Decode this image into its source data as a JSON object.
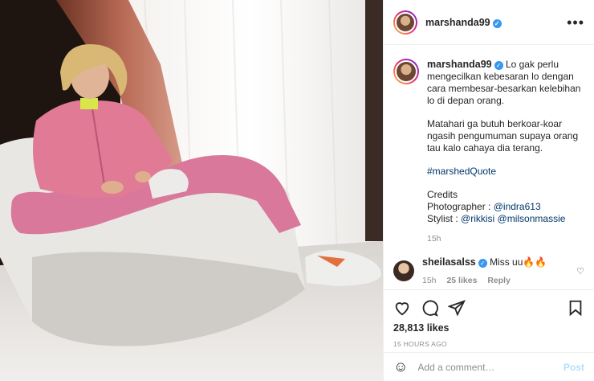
{
  "colors": {
    "accent": "#3897f0",
    "post_button_disabled": "#b2dffc",
    "link": "#00376b",
    "muted": "#8e8e8e"
  },
  "header": {
    "username": "marshanda99",
    "verified_icon": "verified-badge-icon",
    "more_icon": "more-options-icon"
  },
  "caption": {
    "username": "marshanda99",
    "paragraph1": "Lo gak perlu mengecilkan kebesaran lo dengan cara membesar-besarkan kelebihan lo di depan orang.",
    "paragraph2": "Matahari ga butuh berkoar-koar ngasih pengumuman supaya orang tau kalo cahaya dia terang.",
    "hashtag": "#marshedQuote",
    "credits_title": "Credits",
    "photographer_label": "Photographer : ",
    "photographer": "@indra613",
    "stylist_label": "Stylist : ",
    "stylist1": "@rikkisi",
    "stylist_sep": " @",
    "stylist2": "milsonmassie",
    "time": "15h"
  },
  "comment": {
    "username": "sheilasalss",
    "text": "Miss uu",
    "emoji": "🔥🔥",
    "time": "15h",
    "likes": "25 likes",
    "reply": "Reply"
  },
  "actions": {
    "like_icon": "heart-icon",
    "comment_icon": "comment-icon",
    "share_icon": "share-icon",
    "save_icon": "bookmark-icon",
    "likes": "28,813 likes",
    "timeago": "15 HOURS AGO"
  },
  "add_comment": {
    "placeholder": "Add a comment…",
    "post_label": "Post",
    "emoji_icon": "emoji-smiley-icon"
  }
}
